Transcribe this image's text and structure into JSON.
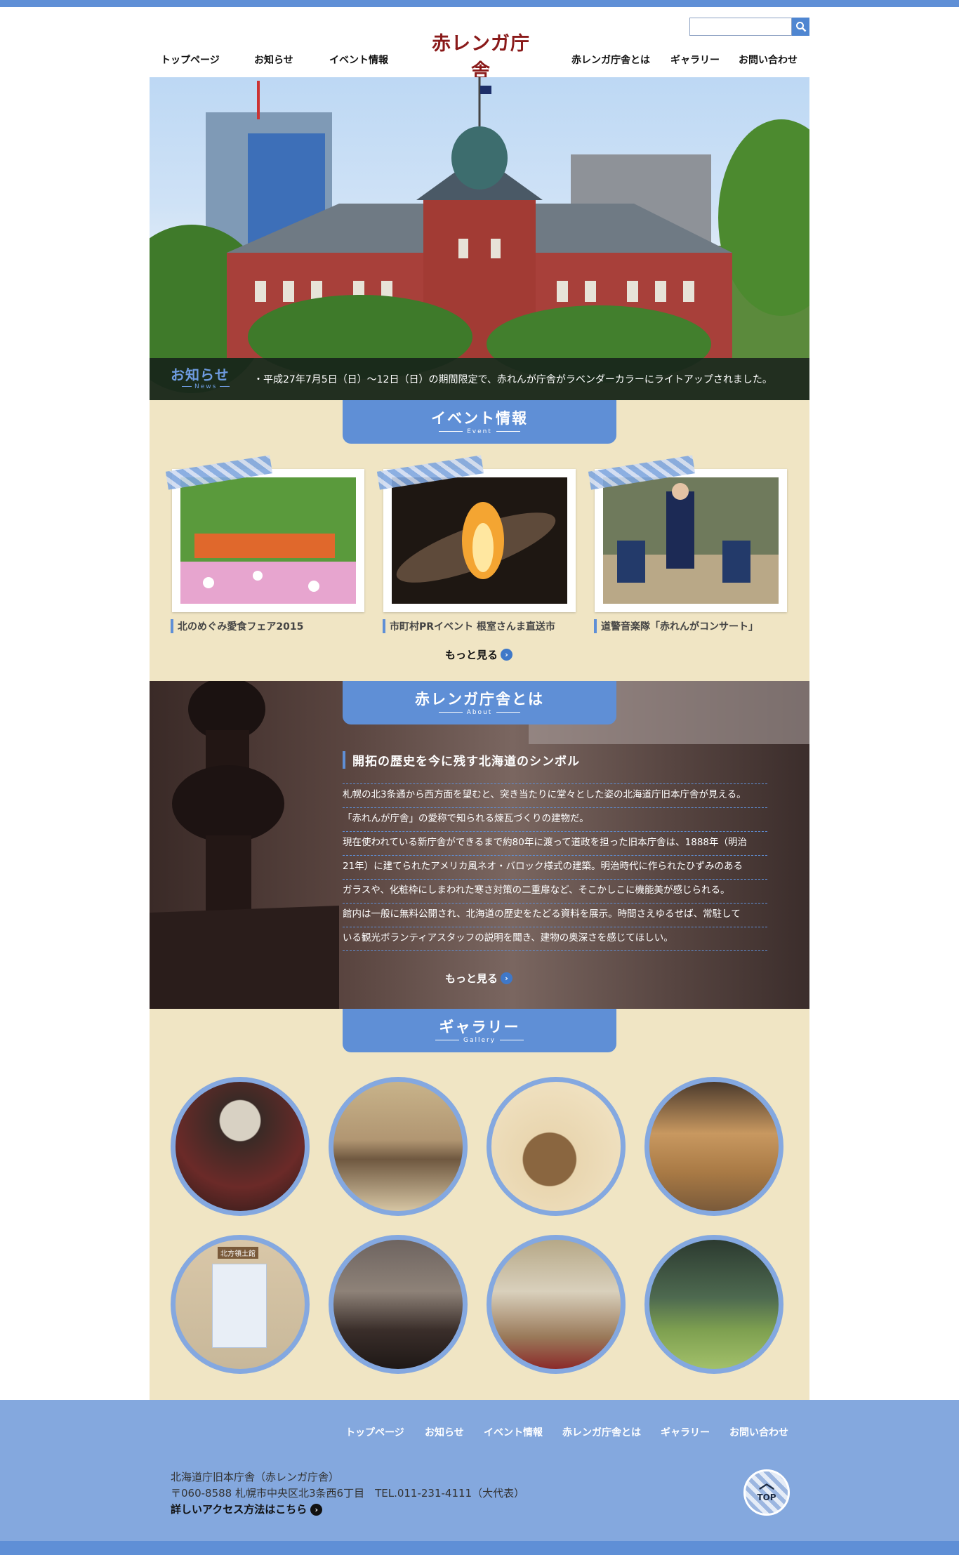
{
  "header": {
    "logo": "赤レンガ庁舎",
    "search_placeholder": "",
    "nav": [
      "トップページ",
      "お知らせ",
      "イベント情報",
      "赤レンガ庁舎とは",
      "ギャラリー",
      "お問い合わせ"
    ]
  },
  "news": {
    "title": "お知らせ",
    "subtitle": "News",
    "item": "・平成27年7月5日（日）～12日（日）の期間限定で、赤れんが庁舎がラベンダーカラーにライトアップされました。"
  },
  "event": {
    "title": "イベント情報",
    "subtitle": "Event",
    "cards": [
      {
        "title": "北のめぐみ愛食フェア2015"
      },
      {
        "title": "市町村PRイベント 根室さんま直送市"
      },
      {
        "title": "道警音楽隊「赤れんがコンサート」"
      }
    ],
    "more": "もっと見る"
  },
  "about": {
    "title": "赤レンガ庁舎とは",
    "subtitle": "About",
    "heading": "開拓の歴史を今に残す北海道のシンボル",
    "lines": [
      "札幌の北3条通から西方面を望むと、突き当たりに堂々とした姿の北海道庁旧本庁舎が見える。",
      "「赤れんが庁舎」の愛称で知られる煉瓦づくりの建物だ。",
      "現在使われている新庁舎ができるまで約80年に渡って道政を担った旧本庁舎は、1888年（明治",
      "21年）に建てられたアメリカ風ネオ・バロック様式の建築。明治時代に作られたひずみのある",
      "ガラスや、化粧枠にしまわれた寒さ対策の二重扉など、そこかしこに機能美が感じられる。",
      "館内は一般に無料公開され、北海道の歴史をたどる資料を展示。時間さえゆるせば、常駐して",
      "いる観光ボランティアスタッフの説明を聞き、建物の奥深さを感じてほしい。"
    ],
    "more": "もっと見る"
  },
  "gallery": {
    "title": "ギャラリー",
    "subtitle": "Gallery",
    "placard": "北方領土館"
  },
  "footer": {
    "nav": [
      "トップページ",
      "お知らせ",
      "イベント情報",
      "赤レンガ庁舎とは",
      "ギャラリー",
      "お問い合わせ"
    ],
    "name": "北海道庁旧本庁舎（赤レンガ庁舎）",
    "address": "〒060-8588 札幌市中央区北3条西6丁目　TEL.011-231-4111（大代表）",
    "access_link": "詳しいアクセス方法はこちら",
    "top_label": "TOP"
  },
  "colors": {
    "accent": "#5f8fd6",
    "beige": "#f0e5c4",
    "footer": "#84a8de"
  }
}
